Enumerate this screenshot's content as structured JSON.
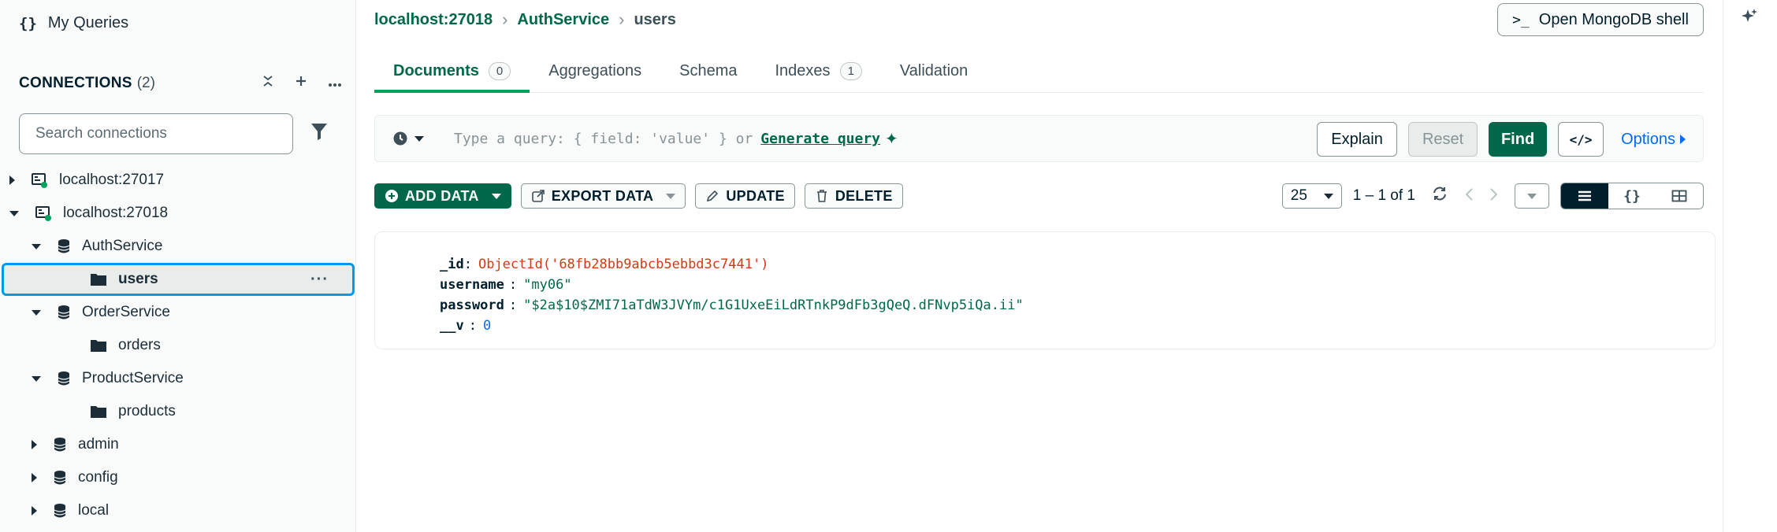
{
  "sidebar": {
    "my_queries": "My Queries",
    "my_queries_icon": "{}",
    "connections_title": "CONNECTIONS",
    "connections_count": "(2)",
    "search_placeholder": "Search connections",
    "tree": [
      {
        "label": "localhost:27017",
        "level": 0,
        "expanded": false,
        "icon": "server-icon",
        "status": "connected"
      },
      {
        "label": "localhost:27018",
        "level": 0,
        "expanded": true,
        "icon": "server-icon",
        "status": "connected"
      },
      {
        "label": "AuthService",
        "level": 1,
        "expanded": true,
        "icon": "database-icon"
      },
      {
        "label": "users",
        "level": 2,
        "icon": "folder-icon",
        "selected": true
      },
      {
        "label": "OrderService",
        "level": 1,
        "expanded": true,
        "icon": "database-icon"
      },
      {
        "label": "orders",
        "level": 2,
        "icon": "folder-icon"
      },
      {
        "label": "ProductService",
        "level": 1,
        "expanded": true,
        "icon": "database-icon"
      },
      {
        "label": "products",
        "level": 2,
        "icon": "folder-icon"
      },
      {
        "label": "admin",
        "level": 1,
        "expanded": false,
        "icon": "database-icon"
      },
      {
        "label": "config",
        "level": 1,
        "expanded": false,
        "icon": "database-icon"
      },
      {
        "label": "local",
        "level": 1,
        "expanded": false,
        "icon": "database-icon"
      }
    ]
  },
  "header": {
    "breadcrumb": [
      "localhost:27018",
      "AuthService",
      "users"
    ],
    "shell_prompt": ">_",
    "shell_label": "Open MongoDB shell"
  },
  "tabs": [
    {
      "label": "Documents",
      "badge": "0",
      "active": true
    },
    {
      "label": "Aggregations"
    },
    {
      "label": "Schema"
    },
    {
      "label": "Indexes",
      "badge": "1"
    },
    {
      "label": "Validation"
    }
  ],
  "query": {
    "placeholder": "Type a query: { field: 'value' } or",
    "generate_label": "Generate query",
    "explain": "Explain",
    "reset": "Reset",
    "find": "Find",
    "code": "</>",
    "options": "Options"
  },
  "toolbar": {
    "add_data": "ADD DATA",
    "export_data": "EXPORT DATA",
    "update": "UPDATE",
    "delete": "DELETE",
    "page_size": "25",
    "range": "1 – 1 of 1"
  },
  "document": [
    {
      "key": "_id",
      "value": "ObjectId('68fb28bb9abcb5ebbd3c7441')",
      "type": "oid"
    },
    {
      "key": "username",
      "value": "\"my06\"",
      "type": "str"
    },
    {
      "key": "password",
      "value": "\"$2a$10$ZMI71aTdW3JVYm/c1G1UxeEiLdRTnkP9dFb3gQeQ.dFNvp5iQa.ii\"",
      "type": "str"
    },
    {
      "key": "__v",
      "value": "0",
      "type": "num"
    }
  ],
  "colors": {
    "accent": "#00684a",
    "selection": "#0498ec",
    "link": "#016bf8",
    "objectid": "#d83713"
  }
}
